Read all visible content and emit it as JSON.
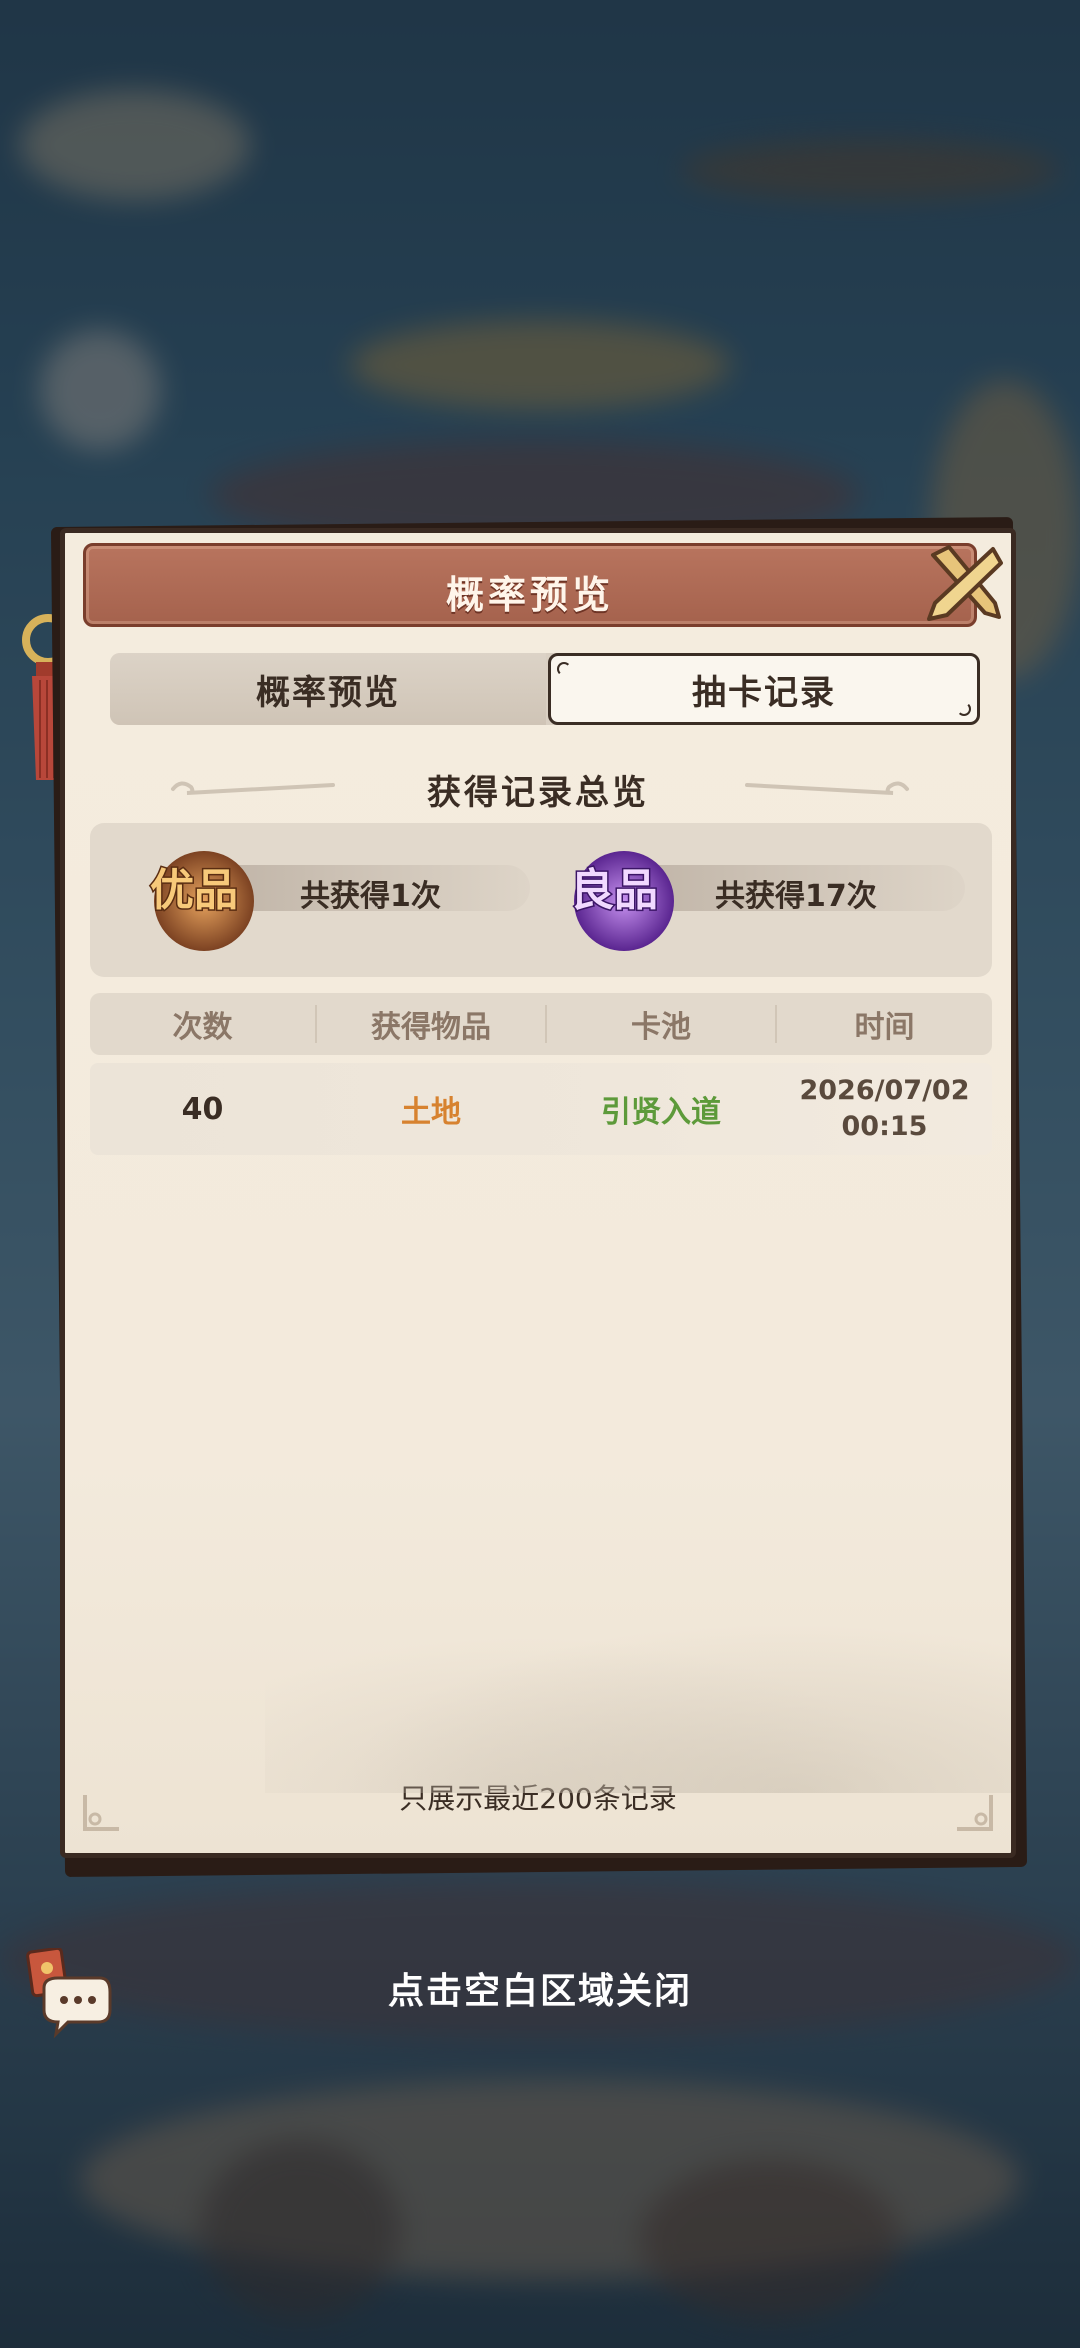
{
  "dialog": {
    "title": "概率预览",
    "tabs": [
      {
        "label": "概率预览",
        "active": false
      },
      {
        "label": "抽卡记录",
        "active": true
      }
    ],
    "summary": {
      "title": "获得记录总览",
      "badges": [
        {
          "badge_text": "优品",
          "count_text": "共获得1次",
          "color": "#b26a2e"
        },
        {
          "badge_text": "良品",
          "count_text": "共获得17次",
          "color": "#8e3fc9"
        }
      ]
    },
    "table": {
      "headers": [
        "次数",
        "获得物品",
        "卡池",
        "时间"
      ],
      "rows": [
        {
          "count": "40",
          "item": "土地",
          "pool": "引贤入道",
          "time_date": "2026/07/02",
          "time_clock": "00:15"
        }
      ]
    },
    "footer_note": "只展示最近200条记录"
  },
  "close_hint": "点击空白区域关闭",
  "colors": {
    "item_orange": "#d7822f",
    "pool_green": "#5d9a3a",
    "title_bar": "#a5624d",
    "panel_bg": "#f4ecde",
    "text_dark": "#3a2d24"
  }
}
